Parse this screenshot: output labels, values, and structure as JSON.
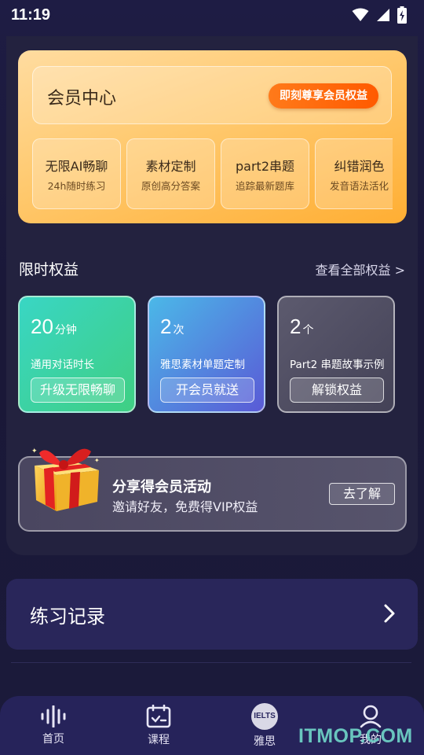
{
  "status_bar": {
    "time": "11:19"
  },
  "vip": {
    "title": "会员中心",
    "cta": "即刻尊享会员权益",
    "features": [
      {
        "title": "无限AI畅聊",
        "subtitle": "24h随时练习"
      },
      {
        "title": "素材定制",
        "subtitle": "原创高分答案"
      },
      {
        "title": "part2串题",
        "subtitle": "追踪最新题库"
      },
      {
        "title": "纠错润色",
        "subtitle": "发音语法活化"
      }
    ]
  },
  "benefits": {
    "title": "限时权益",
    "view_all": "查看全部权益 >",
    "cards": [
      {
        "value": "20",
        "unit": "分钟",
        "desc": "通用对话时长",
        "button": "升级无限畅聊"
      },
      {
        "value": "2",
        "unit": "次",
        "desc": "雅思素材单题定制",
        "button": "开会员就送"
      },
      {
        "value": "2",
        "unit": "个",
        "desc": "Part2 串题故事示例",
        "button": "解锁权益"
      }
    ]
  },
  "share": {
    "title": "分享得会员活动",
    "subtitle": "邀请好友，免费得VIP权益",
    "button": "去了解"
  },
  "practice": {
    "title": "练习记录"
  },
  "nav": {
    "items": [
      {
        "label": "首页",
        "icon": "waveform-icon"
      },
      {
        "label": "课程",
        "icon": "calendar-check-icon"
      },
      {
        "label": "雅思",
        "icon": "ielts-icon",
        "badge": "IELTS"
      },
      {
        "label": "我的",
        "icon": "user-icon"
      }
    ]
  },
  "watermark": "ITMOP.COM",
  "colors": {
    "accent_orange": "#ff6a0a",
    "background": "#1e1c44",
    "nav_bg": "#26235a"
  }
}
